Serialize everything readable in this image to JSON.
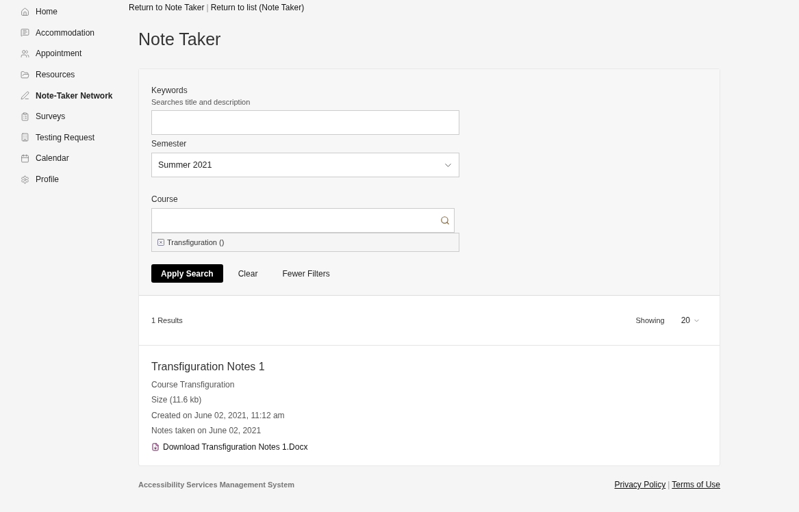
{
  "sidebar": {
    "items": [
      {
        "label": "Home",
        "selected": false
      },
      {
        "label": "Accommodation",
        "selected": false
      },
      {
        "label": "Appointment",
        "selected": false
      },
      {
        "label": "Resources",
        "selected": false
      },
      {
        "label": "Note-Taker Network",
        "selected": true
      },
      {
        "label": "Surveys",
        "selected": false
      },
      {
        "label": "Testing Request",
        "selected": false
      },
      {
        "label": "Calendar",
        "selected": false
      },
      {
        "label": "Profile",
        "selected": false
      }
    ]
  },
  "breadcrumb": {
    "links": [
      "Return to Note Taker",
      "Return to list (Note Taker)"
    ],
    "separator": "|"
  },
  "title": "Note Taker",
  "filters": {
    "keywords": {
      "label": "Keywords",
      "hint": "Searches title and description"
    },
    "semester": {
      "label": "Semester",
      "value": "Summer 2021"
    },
    "course": {
      "label": "Course",
      "chips": [
        "Transfiguration ()"
      ]
    },
    "buttons": {
      "apply": "Apply Search",
      "clear": "Clear",
      "fewer": "Fewer Filters"
    }
  },
  "results": {
    "count": "1 Results",
    "showing_label": "Showing",
    "page_size": "20",
    "items": [
      {
        "title": "Transfiguration Notes 1",
        "lines": [
          "Course Transfiguration",
          "Size (11.6 kb)",
          "Created on June 02, 2021, 11:12 am",
          "Notes taken on June 02, 2021"
        ],
        "download": "Download Transfiguration Notes 1.Docx"
      }
    ]
  },
  "footer": {
    "system": "Accessibility Services Management System",
    "links": [
      "Privacy Policy",
      "Terms of Use"
    ],
    "separator": "|"
  }
}
